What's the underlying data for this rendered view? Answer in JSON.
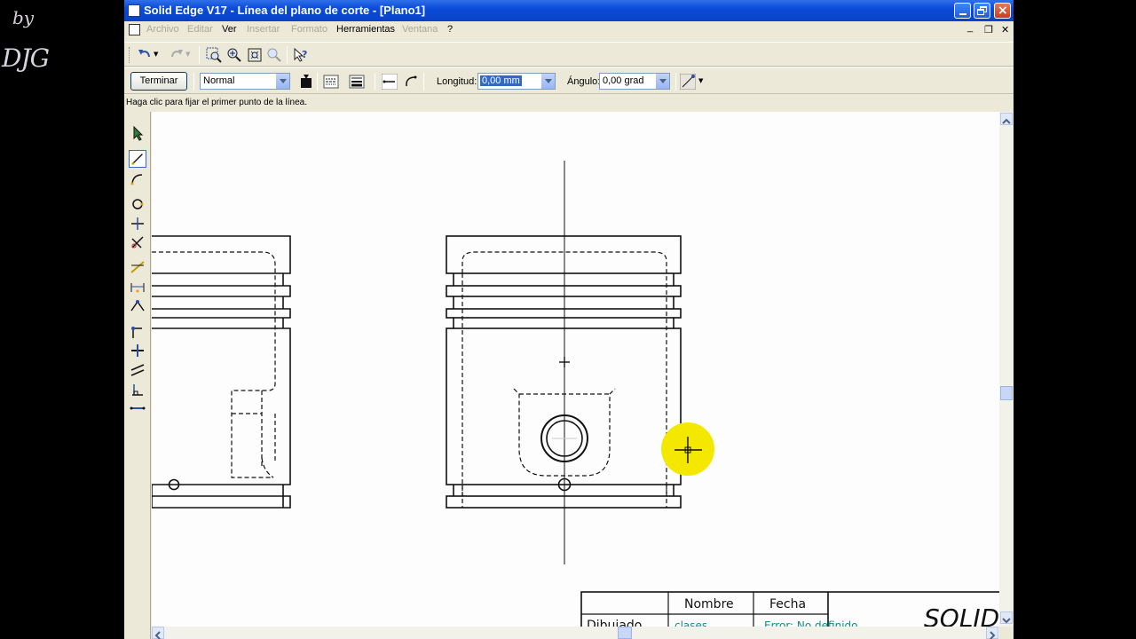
{
  "watermark": {
    "line1": "by",
    "line2": "DJG"
  },
  "window": {
    "title": "Solid Edge V17 - Línea del plano de corte - [Plano1]"
  },
  "menu": {
    "items": [
      {
        "label": "Archivo",
        "enabled": false
      },
      {
        "label": "Editar",
        "enabled": false
      },
      {
        "label": "Ver",
        "enabled": true
      },
      {
        "label": "Insertar",
        "enabled": false
      },
      {
        "label": "Formato",
        "enabled": false
      },
      {
        "label": "Herramientas",
        "enabled": true
      },
      {
        "label": "Ventana",
        "enabled": false
      },
      {
        "label": "?",
        "enabled": true
      }
    ]
  },
  "ribbon": {
    "finish_label": "Terminar",
    "style_value": "Normal",
    "length_label": "Longitud:",
    "length_value": "0,00 mm",
    "angle_label": "Ángulo:",
    "angle_value": "0,00 grad"
  },
  "prompt": "Haga clic para fijar el primer punto de la línea.",
  "title_block": {
    "col_name": "Nombre",
    "col_date": "Fecha",
    "row_label": "Dibujado",
    "row_name": "clases",
    "row_date": "Error: No definido",
    "logo": "SOLID E"
  },
  "colors": {
    "titlebar": "#0a4bd9",
    "chrome": "#ece9d8",
    "canvas": "#fdfdfd",
    "cursor_highlight": "#f5e800",
    "title_block_text": "#128a8a"
  }
}
